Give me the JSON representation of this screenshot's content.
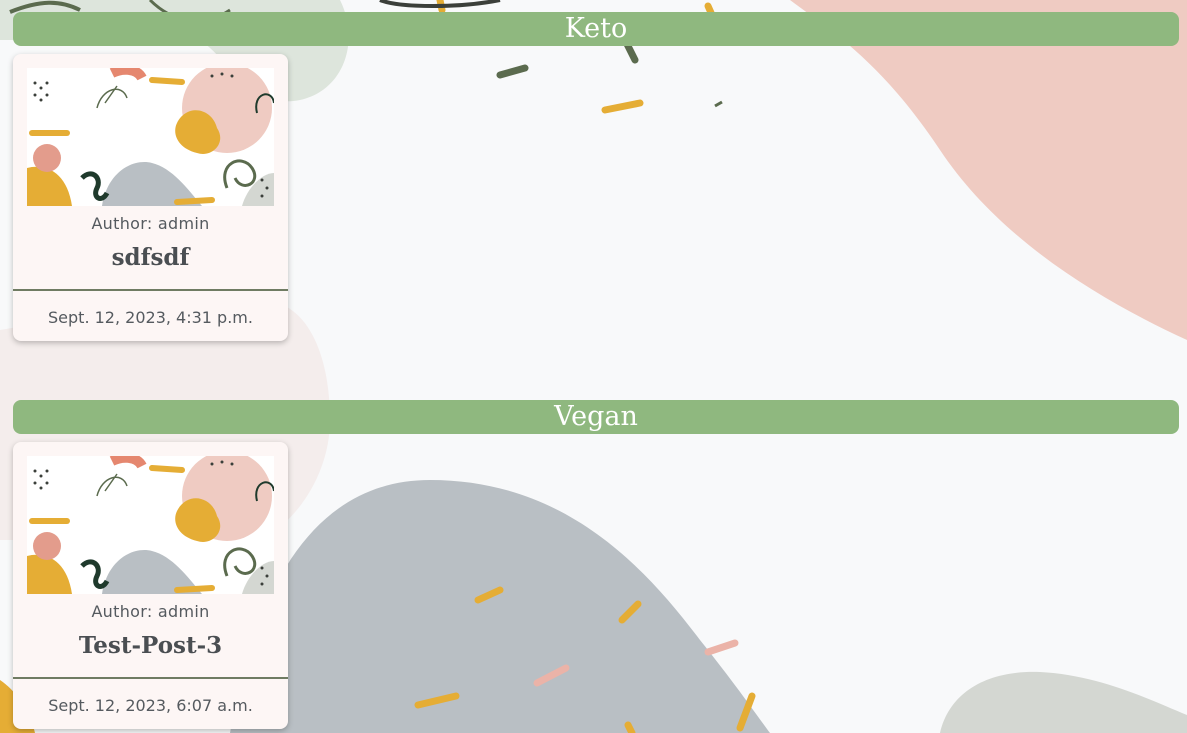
{
  "colors": {
    "header_bg": "#8fb87f",
    "card_bg": "#fdf6f5",
    "page_bg": "#f8f9fa"
  },
  "categories": [
    {
      "title": "Keto",
      "post": {
        "author_label": "Author: admin",
        "title": "sdfsdf",
        "date": "Sept. 12, 2023, 4:31 p.m.",
        "thumbnail_icon": "abstract-art-thumbnail"
      }
    },
    {
      "title": "Vegan",
      "post": {
        "author_label": "Author: admin",
        "title": "Test-Post-3",
        "date": "Sept. 12, 2023, 6:07 a.m.",
        "thumbnail_icon": "abstract-art-thumbnail"
      }
    }
  ]
}
